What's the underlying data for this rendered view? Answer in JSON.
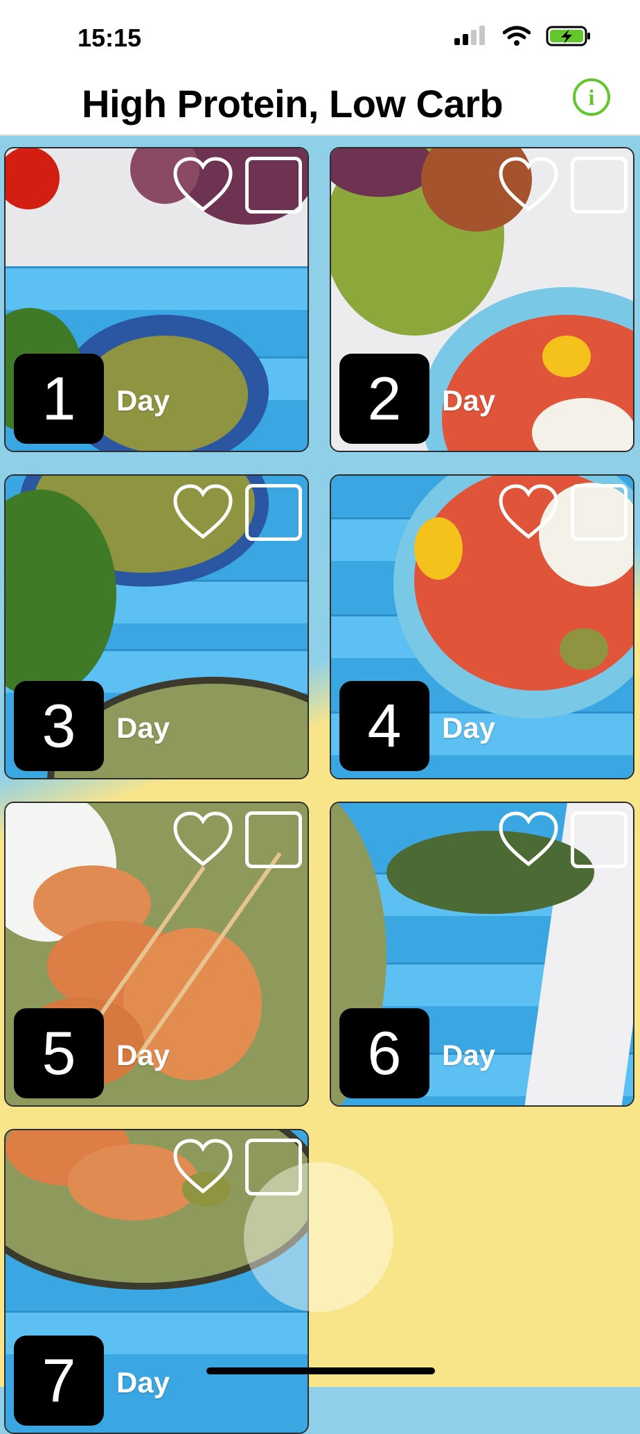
{
  "status": {
    "time": "15:15"
  },
  "header": {
    "title": "High Protein, Low Carb",
    "info_icon": "info-icon"
  },
  "days": [
    {
      "number": "1",
      "label": "Day"
    },
    {
      "number": "2",
      "label": "Day"
    },
    {
      "number": "3",
      "label": "Day"
    },
    {
      "number": "4",
      "label": "Day"
    },
    {
      "number": "5",
      "label": "Day"
    },
    {
      "number": "6",
      "label": "Day"
    },
    {
      "number": "7",
      "label": "Day"
    }
  ],
  "colors": {
    "accent": "#61c72a",
    "background_top": "#8fd0e8",
    "background_bottom": "#f8e58a"
  }
}
